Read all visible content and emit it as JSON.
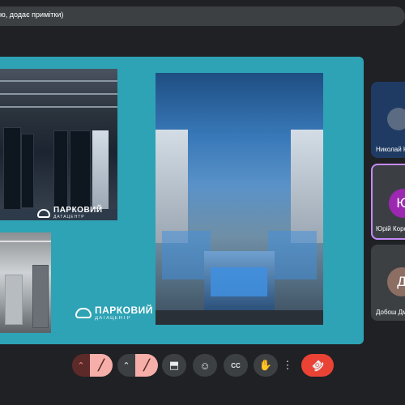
{
  "topbar": {
    "text": "ю, додає примітки)"
  },
  "slide": {
    "logo_small": {
      "name": "ПАРКОВИЙ",
      "sub": "ДАТАЦЕНТР"
    },
    "logo_big": {
      "name": "ПАРКОВИЙ",
      "sub": "ДАТАЦЕНТР"
    }
  },
  "participants": [
    {
      "name": "Николай К",
      "initials": ""
    },
    {
      "name": "Юрій Коро",
      "initials": "Ю"
    },
    {
      "name": "Добош Дм",
      "initials": "Д"
    }
  ],
  "controls": {
    "chevron": "⌃",
    "mic": "🎙",
    "camera": "▭",
    "present": "⬒",
    "emoji": "☺",
    "captions": "CC",
    "hand": "✋",
    "more": "⋮",
    "end": "☎"
  }
}
